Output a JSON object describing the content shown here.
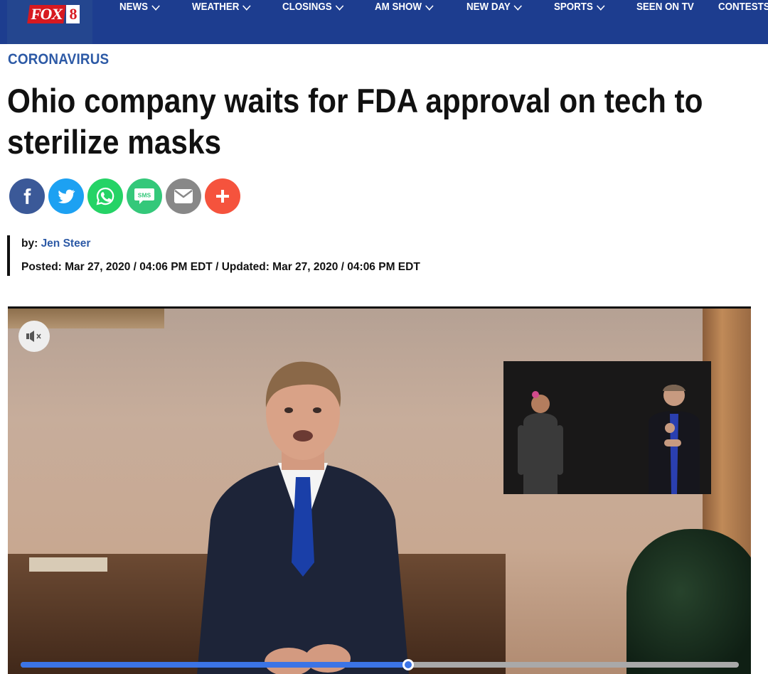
{
  "brand": {
    "logo_word": "FOX",
    "logo_number": "8",
    "colors": {
      "nav_bg": "#1d3d8f",
      "logo_red": "#d71920",
      "link_blue": "#2d5aa6"
    }
  },
  "nav": {
    "items": [
      {
        "label": "NEWS",
        "has_dropdown": true
      },
      {
        "label": "WEATHER",
        "has_dropdown": true
      },
      {
        "label": "CLOSINGS",
        "has_dropdown": true
      },
      {
        "label": "AM SHOW",
        "has_dropdown": true
      },
      {
        "label": "NEW DAY",
        "has_dropdown": true
      },
      {
        "label": "SPORTS",
        "has_dropdown": true
      },
      {
        "label": "SEEN ON TV",
        "has_dropdown": false
      },
      {
        "label": "CONTESTS",
        "has_dropdown": false
      }
    ]
  },
  "article": {
    "category": "CORONAVIRUS",
    "headline_line1": "Ohio company waits for FDA approval on tech to",
    "headline_line2": "sterilize masks",
    "byline_prefix": "by:",
    "author": "Jen Steer",
    "dates": "Posted: Mar 27, 2020 / 04:06 PM EDT / Updated: Mar 27, 2020 / 04:06 PM EDT"
  },
  "share": [
    {
      "icon": "facebook-icon",
      "color": "#3b5998"
    },
    {
      "icon": "twitter-icon",
      "color": "#1da1f2"
    },
    {
      "icon": "whatsapp-icon",
      "color": "#25d366"
    },
    {
      "icon": "sms-icon",
      "color": "#34c87a",
      "text": "SMS"
    },
    {
      "icon": "email-icon",
      "color": "#888888"
    },
    {
      "icon": "plus-icon",
      "color": "#f5533d"
    }
  ],
  "video": {
    "muted": true,
    "progress_fraction": 0.54
  }
}
